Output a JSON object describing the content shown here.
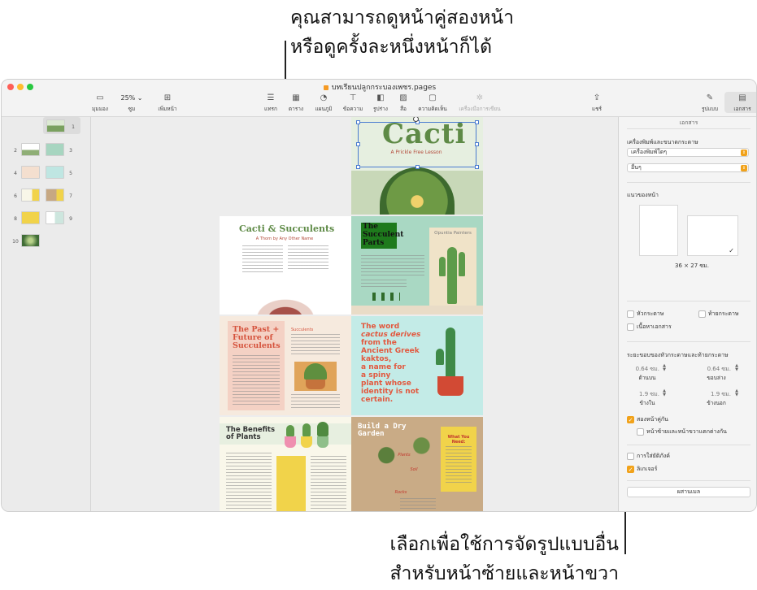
{
  "callouts": {
    "top_line1": "คุณสามารถดูหน้าคู่สองหน้า",
    "top_line2": "หรือดูครั้งละหนึ่งหน้าก็ได้",
    "bottom_line1": "เลือกเพื่อใช้การจัดรูปแบบอื่น",
    "bottom_line2": "สำหรับหน้าซ้ายและหน้าขวา"
  },
  "window": {
    "title": "บทเรียนปลูกกระบองเพชร.pages",
    "traffic_colors": [
      "#fe5f57",
      "#febc2e",
      "#28c840"
    ]
  },
  "toolbar": {
    "view": "มุมมอง",
    "zoom_value": "25% ⌄",
    "zoom": "ซูม",
    "add_page": "เพิ่มหน้า",
    "insert": "แทรก",
    "table": "ตาราง",
    "chart": "แผนภูมิ",
    "text": "ข้อความ",
    "shape": "รูปร่าง",
    "media": "สื่อ",
    "comment": "ความคิดเห็น",
    "writing_tools": "เครื่องมือการเขียน",
    "share": "แชร์",
    "format": "รูปแบบ",
    "document": "เอกสาร"
  },
  "sidebar": {
    "page_numbers": [
      "1",
      "2",
      "3",
      "4",
      "5",
      "6",
      "7",
      "8",
      "9",
      "10"
    ]
  },
  "pages": {
    "cover_title": "Cacti",
    "cover_subtitle": "A Prickle Free Lesson",
    "p2_title": "Cacti & Succulents",
    "p2_subtitle": "A Thorn by Any Other Name",
    "p3_title_1": "The",
    "p3_title_2": "Succulent",
    "p3_title_3": "Parts",
    "p3_label": "Opuntia Painters",
    "p4_title": "The Past + Future of Succulents",
    "p4_sub": "Succulents",
    "p5_line1": "The word",
    "p5_line2": "cactus derives",
    "p5_line3": "from the",
    "p5_line4": "Ancient Greek",
    "p5_line5": "kaktos,",
    "p5_line6": "a name for",
    "p5_line7": "a spiny",
    "p5_line8": "plant whose",
    "p5_line9": "identity is not",
    "p5_line10": "certain.",
    "p6_title": "The Benefits of Plants",
    "p7_title": "Build a Dry Garden",
    "p7_card": "What You Need:",
    "p7_tag1": "Plants",
    "p7_tag2": "Soil",
    "p7_tag3": "Rocks"
  },
  "inspector": {
    "tab": "เอกสาร",
    "printer_paper_label": "เครื่องพิมพ์และขนาดกระดาษ",
    "printer_value": "เครื่องพิมพ์ใดๆ",
    "paper_value": "อื่นๆ",
    "orientation_label": "แนวของหน้า",
    "paper_size": "36 × 27 ซม.",
    "header_cb": "หัวกระดาษ",
    "footer_cb": "ท้ายกระดาษ",
    "document_body_cb": "เนื้อหาเอกสาร",
    "margins_label": "ระยะขอบของหัวกระดาษและท้ายกระดาษ",
    "top_value": "0.64 ซม.",
    "top_label": "ด้านบน",
    "bottom_value": "0.64 ซม.",
    "bottom_label": "ขอบล่าง",
    "inside_value": "1.9 ซม.",
    "inside_label": "ข้างใน",
    "outside_value": "1.9 ซม.",
    "outside_label": "ข้างนอก",
    "facing_pages_cb": "สองหน้าคู่กัน",
    "left_right_diff_cb": "หน้าซ้ายและหน้าขวาแตกต่างกัน",
    "hyphenation_cb": "การใส่ยัติภังค์",
    "ligatures_cb": "ลิเกเจอร์",
    "merge_button": "ผสานเมล"
  }
}
